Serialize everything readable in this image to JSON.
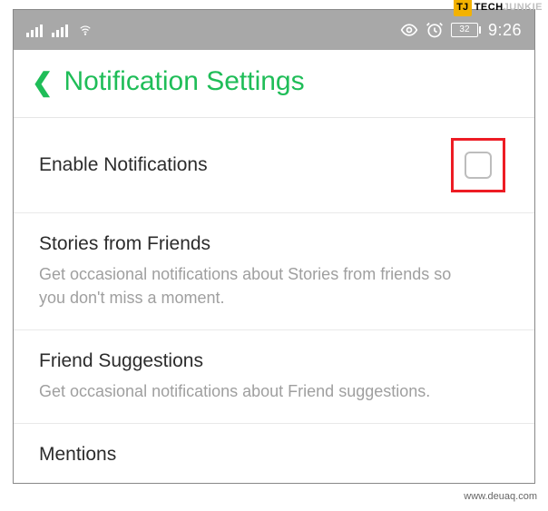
{
  "watermark": {
    "brand_left": "TECH",
    "brand_right": "JUNKIE",
    "url": "www.deuaq.com"
  },
  "statusbar": {
    "battery": "32",
    "time": "9:26"
  },
  "header": {
    "title": "Notification Settings"
  },
  "sections": {
    "enable": {
      "title": "Enable Notifications"
    },
    "stories": {
      "title": "Stories from Friends",
      "desc": "Get occasional notifications about Stories from friends so you don't miss a moment."
    },
    "suggestions": {
      "title": "Friend Suggestions",
      "desc": "Get occasional notifications about Friend suggestions."
    },
    "mentions": {
      "title": "Mentions"
    }
  }
}
